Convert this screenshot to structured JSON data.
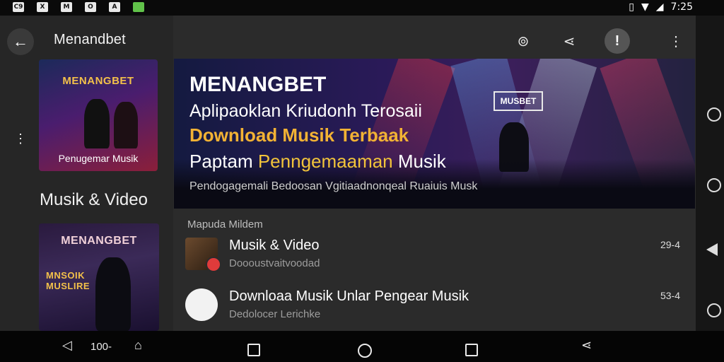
{
  "status_bar": {
    "left_icons": [
      "C9",
      "X",
      "M",
      "O",
      "A",
      "green-app"
    ],
    "time": "7:25"
  },
  "header": {
    "title": "Menandbet"
  },
  "sidebar": {
    "thumb1": {
      "brand": "MENANGBET",
      "caption": "Penugemar Musik"
    },
    "heading": "Musik & Video",
    "thumb2": {
      "brand": "MENANGBET",
      "overlay": "MNSOIK MUSLIRE"
    }
  },
  "banner": {
    "brand": "MENANGBET",
    "line1": "Aplipaoklan Kriudonh Terosaii",
    "line2": "Download Musik Terbaak",
    "line3_a": "Paptam",
    "line3_b": "Penngemaaman",
    "line3_c": "Musik",
    "sub": "Pendogagemali Bedoosan Vgitiaadnonqeal Ruaiuis Musk",
    "stage_sign": "MUSBET"
  },
  "list": {
    "section_label": "Mapuda Mildem",
    "items": [
      {
        "title": "Musik & Video",
        "subtitle": "Doooustvaitvoodad",
        "count": "29-4"
      },
      {
        "title": "Downloaa Musik Unlar Pengear Musik",
        "subtitle": "Dedolocer Lerichke",
        "count": "53-4"
      }
    ]
  },
  "navbar": {
    "volume": "100-"
  }
}
